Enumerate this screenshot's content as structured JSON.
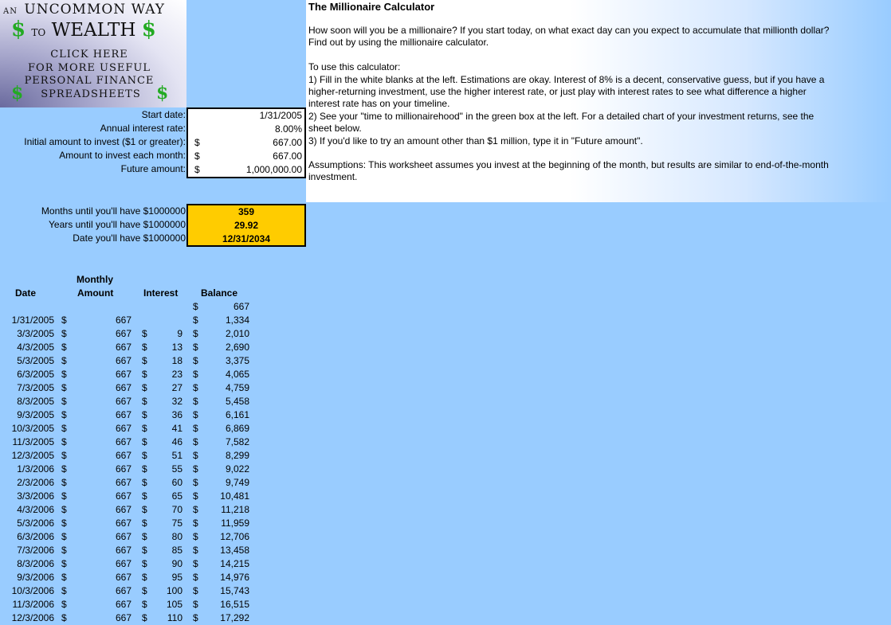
{
  "logo": {
    "line1_small": "AN",
    "line1": "UNCOMMON  WAY",
    "line2_small": "TO",
    "line2": "WEALTH",
    "dollar": "$",
    "click": [
      "CLICK HERE",
      "FOR MORE USEFUL",
      "PERSONAL FINANCE",
      "SPREADSHEETS"
    ]
  },
  "instructions": {
    "title": "The Millionaire Calculator",
    "p1": "How soon will you be a millionaire?  If you start today, on what exact day can you expect to accumulate that millionth dollar?  Find out by using the millionaire calculator.",
    "p2": "To use this calculator:",
    "p3": "1) Fill in the white blanks at the left.  Estimations are okay.  Interest of 8% is a decent, conservative  guess, but if you have a higher-returning  investment,  use the higher interest rate, or just play with interest rates to see what difference  a higher interest rate has on your timeline.",
    "p4": "2) See your \"time to millionairehood\"  in the green box at the left.  For a detailed chart of your investment returns,  see the sheet below.",
    "p5": "3) If you'd like to try an amount other than $1 million, type it in \"Future amount\".",
    "p6": "Assumptions: This worksheet assumes you invest at the beginning of the month, but results are similar to end-of-the-month  investment."
  },
  "inputs": {
    "start_label": "Start date:",
    "start_value": "1/31/2005",
    "rate_label": "Annual interest rate:",
    "rate_value": "8.00%",
    "initial_label": "Initial amount to invest ($1 or greater):",
    "initial_value": "667.00",
    "monthly_label": "Amount to invest each month:",
    "monthly_value": "667.00",
    "future_label": "Future amount:",
    "future_value": "1,000,000.00",
    "currency": "$"
  },
  "results": {
    "months_label": "Months until you'll have $1000000",
    "months_value": "359",
    "years_label": "Years until you'll have $1000000",
    "years_value": "29.92",
    "date_label": "Date you'll have $1000000",
    "date_value": "12/31/2034"
  },
  "table": {
    "headers": {
      "date": "Date",
      "monthly1": "Monthly",
      "monthly2": "Amount",
      "interest": "Interest",
      "balance": "Balance"
    },
    "initial_balance": "667",
    "rows": [
      {
        "date": "1/31/2005",
        "amount": "667",
        "interest": "",
        "balance": "1,334"
      },
      {
        "date": "3/3/2005",
        "amount": "667",
        "interest": "9",
        "balance": "2,010"
      },
      {
        "date": "4/3/2005",
        "amount": "667",
        "interest": "13",
        "balance": "2,690"
      },
      {
        "date": "5/3/2005",
        "amount": "667",
        "interest": "18",
        "balance": "3,375"
      },
      {
        "date": "6/3/2005",
        "amount": "667",
        "interest": "23",
        "balance": "4,065"
      },
      {
        "date": "7/3/2005",
        "amount": "667",
        "interest": "27",
        "balance": "4,759"
      },
      {
        "date": "8/3/2005",
        "amount": "667",
        "interest": "32",
        "balance": "5,458"
      },
      {
        "date": "9/3/2005",
        "amount": "667",
        "interest": "36",
        "balance": "6,161"
      },
      {
        "date": "10/3/2005",
        "amount": "667",
        "interest": "41",
        "balance": "6,869"
      },
      {
        "date": "11/3/2005",
        "amount": "667",
        "interest": "46",
        "balance": "7,582"
      },
      {
        "date": "12/3/2005",
        "amount": "667",
        "interest": "51",
        "balance": "8,299"
      },
      {
        "date": "1/3/2006",
        "amount": "667",
        "interest": "55",
        "balance": "9,022"
      },
      {
        "date": "2/3/2006",
        "amount": "667",
        "interest": "60",
        "balance": "9,749"
      },
      {
        "date": "3/3/2006",
        "amount": "667",
        "interest": "65",
        "balance": "10,481"
      },
      {
        "date": "4/3/2006",
        "amount": "667",
        "interest": "70",
        "balance": "11,218"
      },
      {
        "date": "5/3/2006",
        "amount": "667",
        "interest": "75",
        "balance": "11,959"
      },
      {
        "date": "6/3/2006",
        "amount": "667",
        "interest": "80",
        "balance": "12,706"
      },
      {
        "date": "7/3/2006",
        "amount": "667",
        "interest": "85",
        "balance": "13,458"
      },
      {
        "date": "8/3/2006",
        "amount": "667",
        "interest": "90",
        "balance": "14,215"
      },
      {
        "date": "9/3/2006",
        "amount": "667",
        "interest": "95",
        "balance": "14,976"
      },
      {
        "date": "10/3/2006",
        "amount": "667",
        "interest": "100",
        "balance": "15,743"
      },
      {
        "date": "11/3/2006",
        "amount": "667",
        "interest": "105",
        "balance": "16,515"
      },
      {
        "date": "12/3/2006",
        "amount": "667",
        "interest": "110",
        "balance": "17,292"
      }
    ]
  }
}
